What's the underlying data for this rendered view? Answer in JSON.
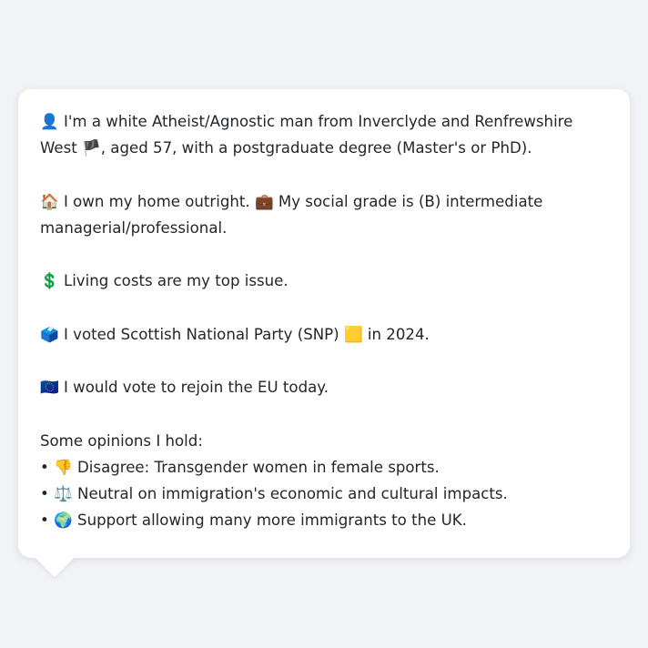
{
  "bio": {
    "icon_person": "👤",
    "line1": "I'm a white Atheist/Agnostic man from Inverclyde and Renfrewshire West",
    "icon_flag": "🏴",
    "line1_cont": ", aged 57, with a postgraduate degree (Master's or PhD)."
  },
  "home": {
    "icon_house": "🏠",
    "text_a": "I own my home outright.",
    "icon_briefcase": "💼",
    "text_b": "My social grade is (B) intermediate managerial/professional."
  },
  "issue": {
    "icon_dollar": "💲",
    "text": "Living costs are my top issue."
  },
  "vote": {
    "icon_ballot": "🗳️",
    "text": "I voted Scottish National Party (SNP)",
    "icon_party": "🟨",
    "text_end": "in 2024."
  },
  "eu": {
    "icon_eu": "🇪🇺",
    "text": "I would vote to rejoin the EU today."
  },
  "opinions": {
    "heading": "Some opinions I hold:",
    "items": [
      {
        "bullet": "•",
        "icon": "👎",
        "text": "Disagree: Transgender women in female sports."
      },
      {
        "bullet": "•",
        "icon": "⚖️",
        "text": "Neutral on immigration's economic and cultural impacts."
      },
      {
        "bullet": "•",
        "icon": "🌍",
        "text": "Support allowing many more immigrants to the UK."
      }
    ]
  }
}
